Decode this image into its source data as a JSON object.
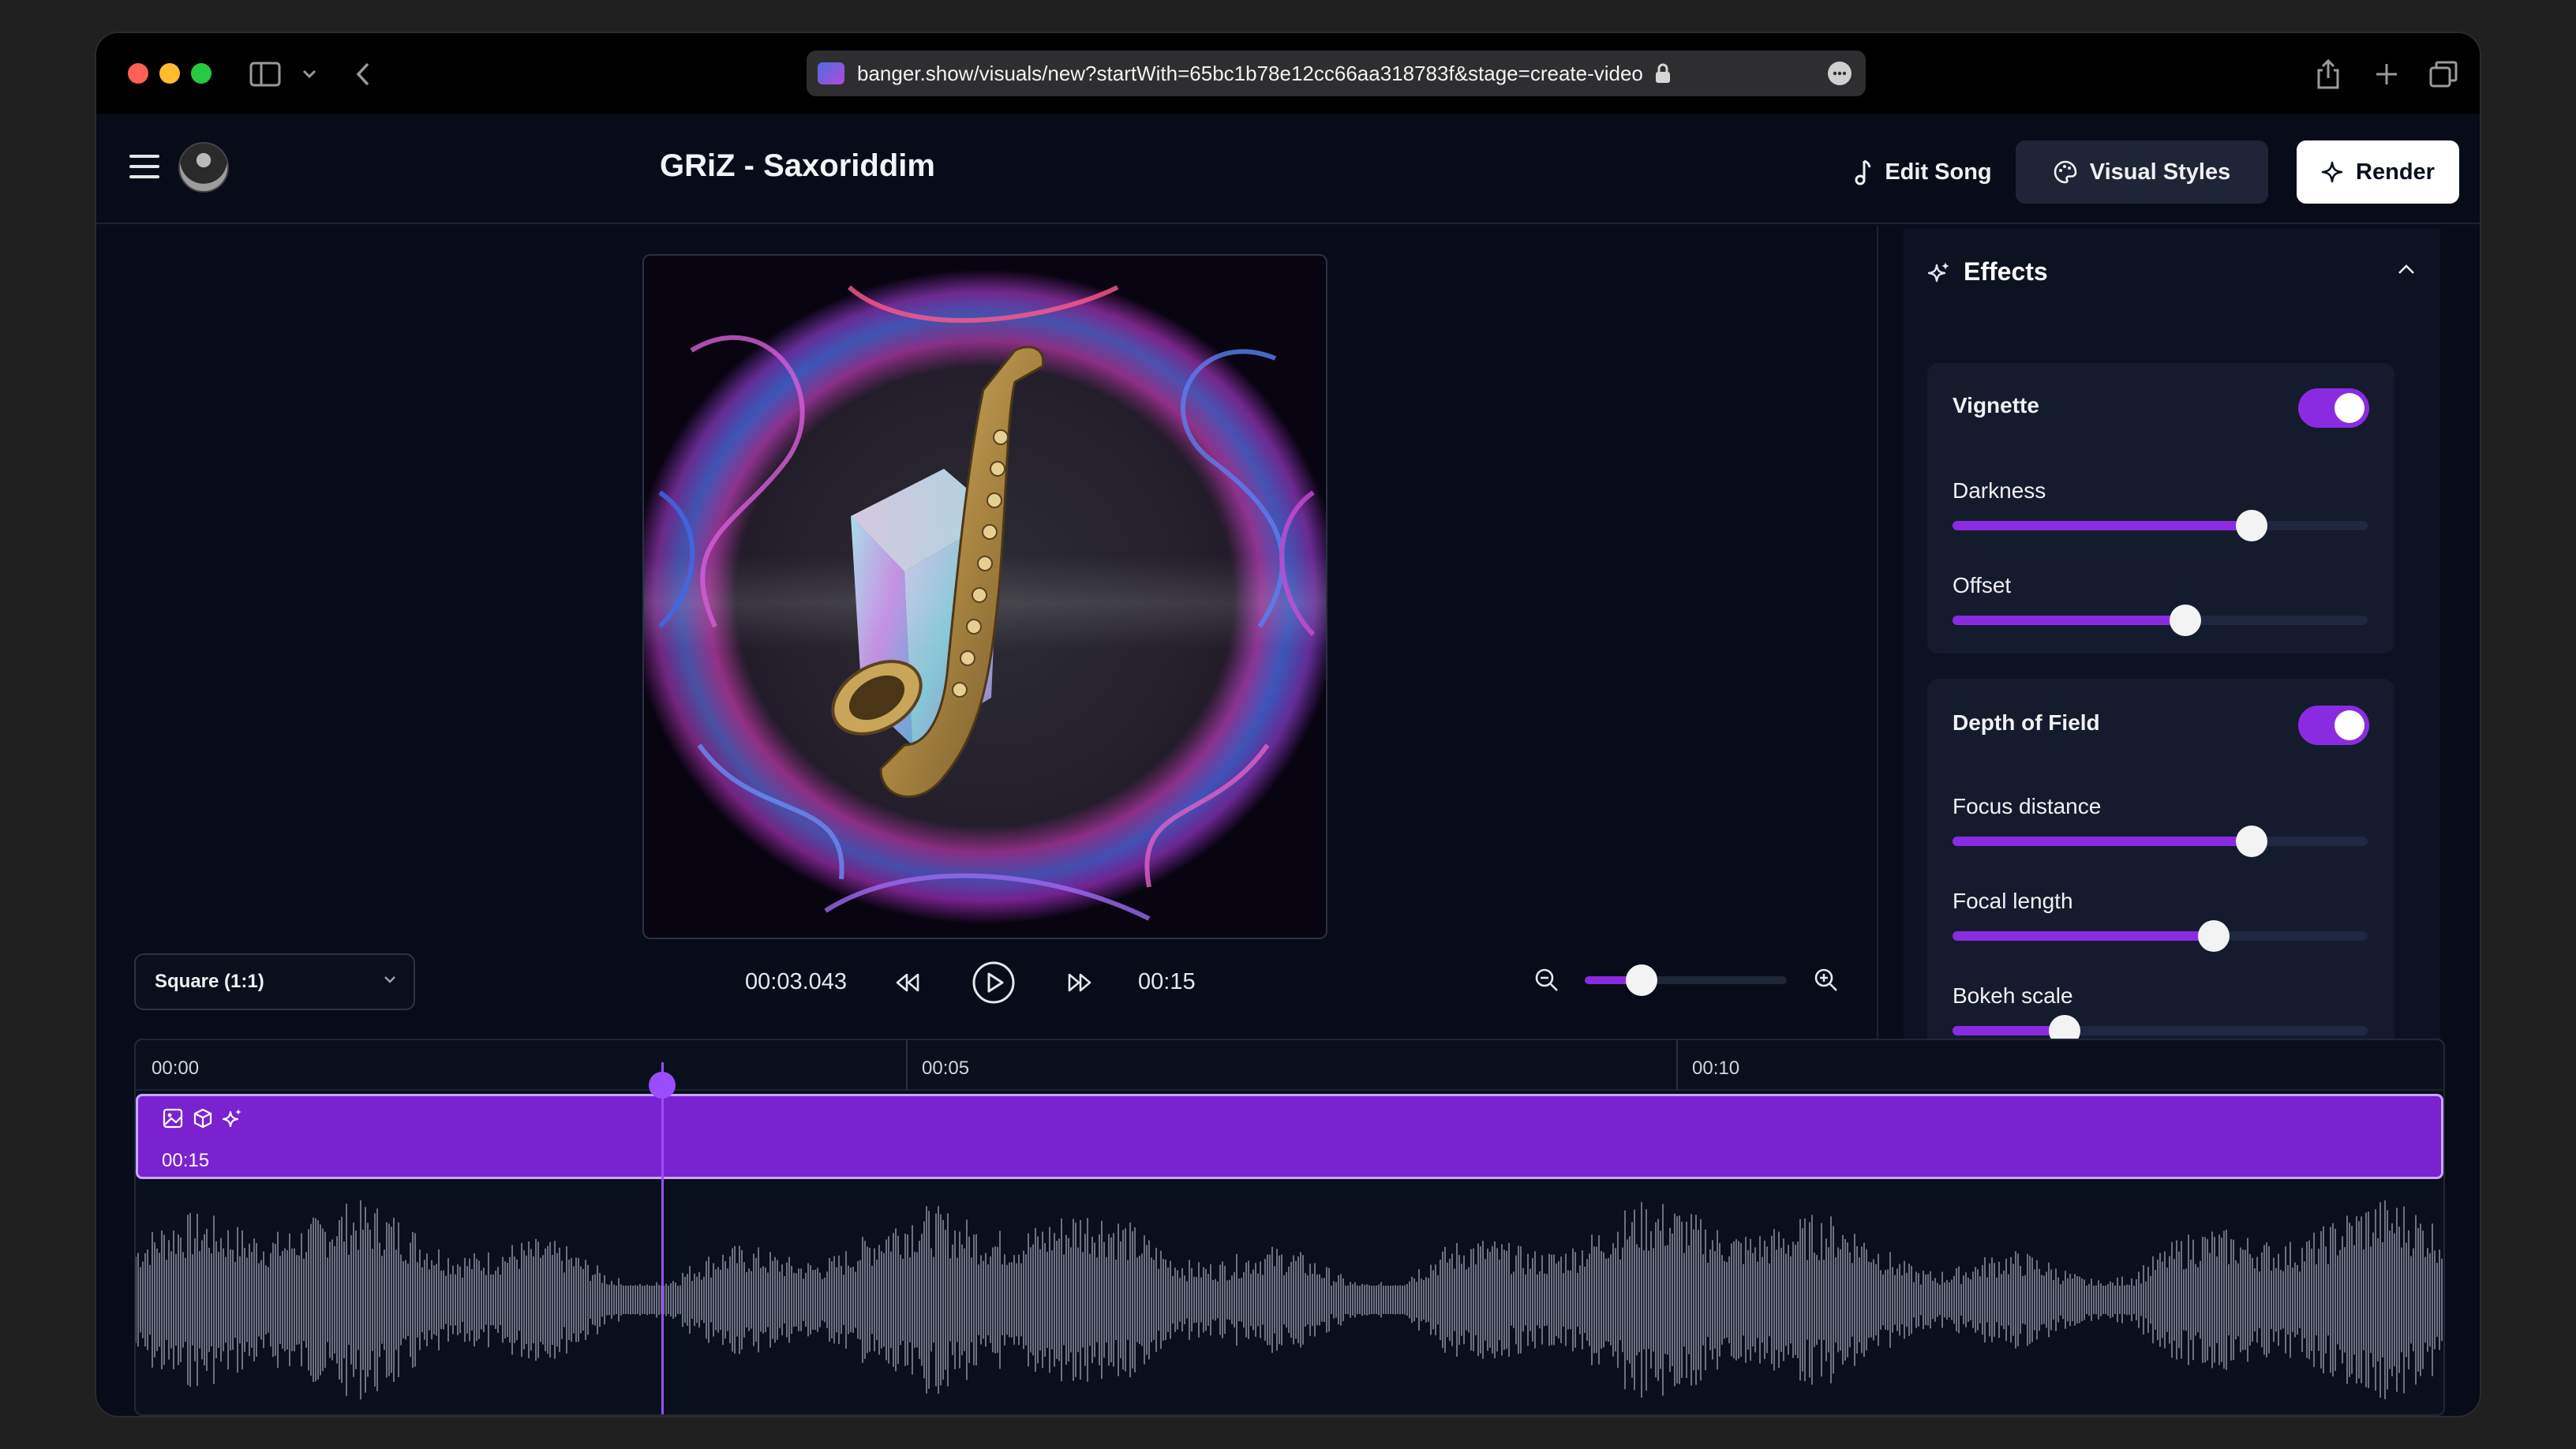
{
  "browser": {
    "url": "banger.show/visuals/new?startWith=65bc1b78e12cc66aa318783f&stage=create-video"
  },
  "header": {
    "song_title": "GRiZ - Saxoriddim",
    "edit_song_label": "Edit Song",
    "visual_styles_label": "Visual Styles",
    "render_label": "Render"
  },
  "player": {
    "aspect_ratio": "Square (1:1)",
    "current_time": "00:03.043",
    "total_time": "00:15",
    "zoom_level": 0.28,
    "playhead_fraction": 0.203
  },
  "effects": {
    "title": "Effects",
    "groups": [
      {
        "name": "Vignette",
        "enabled": true,
        "sliders": [
          {
            "label": "Darkness",
            "value": 0.72
          },
          {
            "label": "Offset",
            "value": 0.56
          }
        ]
      },
      {
        "name": "Depth of Field",
        "enabled": true,
        "sliders": [
          {
            "label": "Focus distance",
            "value": 0.72
          },
          {
            "label": "Focal length",
            "value": 0.63
          },
          {
            "label": "Bokeh scale",
            "value": 0.27
          }
        ]
      }
    ]
  },
  "timeline": {
    "ticks": [
      "00:00",
      "00:05",
      "00:10"
    ],
    "clip_duration": "00:15"
  },
  "colors": {
    "accent": "#8a2be2",
    "clip": "#7a22d0",
    "background": "#080c19"
  },
  "icons": [
    "sidebar-icon",
    "chevron-down-icon",
    "back-icon",
    "share-icon",
    "new-tab-icon",
    "tabs-icon",
    "menu-icon",
    "music-note-icon",
    "palette-icon",
    "sparkle-icon",
    "rewind-icon",
    "play-icon",
    "fast-forward-icon",
    "zoom-out-icon",
    "zoom-in-icon",
    "image-icon",
    "cube-icon",
    "chevron-up-icon"
  ]
}
